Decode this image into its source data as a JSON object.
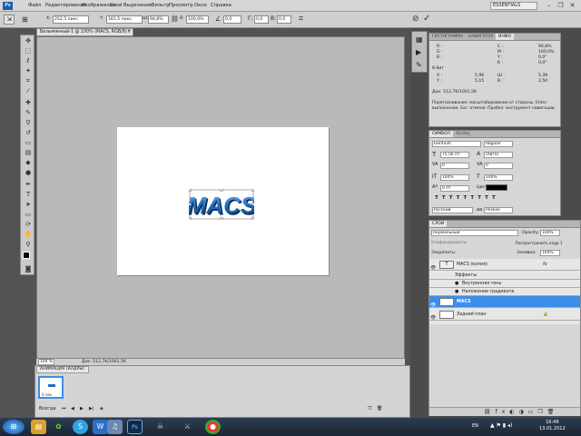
{
  "menu": {
    "logo": "Ps",
    "items": [
      "Файл",
      "Редактирование",
      "Изображение",
      "Слой",
      "Выделение",
      "Фильтр",
      "Просмотр",
      "Окно",
      "Справка"
    ],
    "workspace": "ESSENTIALS"
  },
  "options": {
    "x_value": "252,5 пикс.",
    "y_value": "181,5 пикс.",
    "w_label": "Ш:",
    "w_value": "94,8%",
    "h_label": "В:",
    "h_value": "100,0%",
    "angle_value": "0,0",
    "h_skew": "0,0",
    "v_skew": "0,0"
  },
  "document": {
    "tab_title": "Безымянный-1 @ 100% (MACS, RGB/8) *",
    "artwork_text": "MACS",
    "zoom": "100 %",
    "doc_size": "Док: 512,7K/1001,5K"
  },
  "animation": {
    "tab": "АНИМАЦИЯ (КАДРЫ)",
    "frame_time": "0 сек.",
    "loop": "Всегда"
  },
  "info_panel": {
    "tabs": [
      "ГИСТОГРАММА",
      "НАВИГАТОР",
      "ИНФО"
    ],
    "r": "R :",
    "g": "G :",
    "b": "B :",
    "c": "C :",
    "m": "M :",
    "yv": "Y :",
    "k": "K :",
    "c_val": "94,8%",
    "m_val": "100,0%",
    "y_val": "0,0°",
    "k_val": "0,0°",
    "bits": "8-бит",
    "x": "X :",
    "y": "Y :",
    "x_val": "5,96",
    "y_val2": "5,15",
    "w": "Ш :",
    "h": "В :",
    "w_val": "5,39",
    "h_val": "2,50",
    "doc": "Док: 512,7K/1001,5K",
    "hint": "Перетаскивание: масштабирование от стороны. Enter: выполнение. Esc: отмена. Пробел: инструмент навигации."
  },
  "char_panel": {
    "tabs": [
      "СИМВОЛ",
      "АБЗАЦ"
    ],
    "font": "Gentium",
    "style": "Regular",
    "size": "75,56 пт",
    "leading": "(Авто)",
    "tracking": "0",
    "kerning": "0",
    "v_scale": "100%",
    "h_scale": "100%",
    "baseline": "0 пт",
    "color_label": "Цвет:",
    "color": "#000000",
    "language": "Русский",
    "antialias": "Резкое"
  },
  "layers": {
    "tab": "СЛОИ",
    "blend": "Нормальный",
    "opacity_label": "Opacity:",
    "opacity": "100%",
    "lock_label": "Закрепить:",
    "propagate": "Распространить кадр 1",
    "fill_label": "Заливка:",
    "fill": "100%",
    "unify": "Унифицировать:",
    "rows": [
      {
        "name": "MACS (копия)",
        "fx": "fx"
      },
      {
        "name": "Эффекты"
      },
      {
        "name": "Внутренняя тень"
      },
      {
        "name": "Наложение градиента"
      },
      {
        "name": "MACS"
      },
      {
        "name": "Задний план"
      }
    ]
  },
  "taskbar": {
    "lang": "EN",
    "time": "16:49",
    "date": "13.01.2012"
  },
  "colors": {
    "accent": "#3b8fe8",
    "artwork_blue": "#1f6fc2"
  }
}
